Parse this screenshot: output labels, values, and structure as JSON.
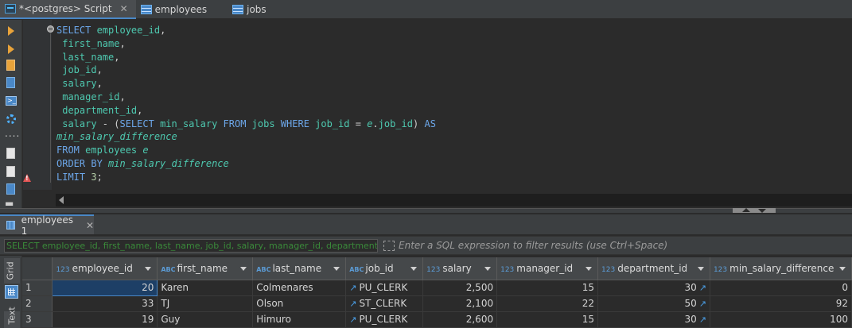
{
  "tabs": [
    {
      "label": "*<postgres> Script",
      "icon": "sql-script-icon",
      "active": true
    },
    {
      "label": "employees",
      "icon": "table-icon"
    },
    {
      "label": "jobs",
      "icon": "table-icon"
    }
  ],
  "editor": {
    "lines": [
      [
        {
          "t": "SELECT ",
          "c": "kw"
        },
        {
          "t": "employee_id",
          "c": "id"
        },
        {
          "t": ",",
          "c": "pl"
        }
      ],
      [
        {
          "t": " first_name",
          "c": "id"
        },
        {
          "t": ",",
          "c": "pl"
        }
      ],
      [
        {
          "t": " last_name",
          "c": "id"
        },
        {
          "t": ",",
          "c": "pl"
        }
      ],
      [
        {
          "t": " job_id",
          "c": "id"
        },
        {
          "t": ",",
          "c": "pl"
        }
      ],
      [
        {
          "t": " salary",
          "c": "id"
        },
        {
          "t": ",",
          "c": "pl"
        }
      ],
      [
        {
          "t": " manager_id",
          "c": "id"
        },
        {
          "t": ",",
          "c": "pl"
        }
      ],
      [
        {
          "t": " department_id",
          "c": "id"
        },
        {
          "t": ",",
          "c": "pl"
        }
      ],
      [
        {
          "t": " salary",
          "c": "id"
        },
        {
          "t": " - (",
          "c": "pl"
        },
        {
          "t": "SELECT ",
          "c": "kw"
        },
        {
          "t": "min_salary ",
          "c": "id"
        },
        {
          "t": "FROM ",
          "c": "kw"
        },
        {
          "t": "jobs ",
          "c": "id"
        },
        {
          "t": "WHERE ",
          "c": "kw"
        },
        {
          "t": "job_id ",
          "c": "id"
        },
        {
          "t": "= ",
          "c": "pl"
        },
        {
          "t": "e",
          "c": "it"
        },
        {
          "t": ".",
          "c": "pl"
        },
        {
          "t": "job_id",
          "c": "id"
        },
        {
          "t": ") ",
          "c": "pl"
        },
        {
          "t": "AS",
          "c": "kw"
        }
      ],
      [
        {
          "t": "min_salary_difference",
          "c": "it"
        }
      ],
      [
        {
          "t": "FROM ",
          "c": "kw"
        },
        {
          "t": "employees ",
          "c": "id"
        },
        {
          "t": "e",
          "c": "it"
        }
      ],
      [
        {
          "t": "ORDER BY ",
          "c": "kw"
        },
        {
          "t": "min_salary_difference",
          "c": "it"
        }
      ],
      [
        {
          "t": "LIMIT ",
          "c": "kw"
        },
        {
          "t": "3",
          "c": "nm"
        },
        {
          "t": ";",
          "c": "pl"
        }
      ]
    ]
  },
  "results": {
    "tab_label": "employees 1",
    "filter_query": "SELECT employee_id, first_name, last_name, job_id, salary, manager_id, department_i",
    "filter_placeholder": "Enter a SQL expression to filter results (use Ctrl+Space)",
    "side_tabs": {
      "grid": "Grid",
      "text": "Text"
    },
    "columns": [
      {
        "name": "employee_id",
        "type": "123"
      },
      {
        "name": "first_name",
        "type": "ABC"
      },
      {
        "name": "last_name",
        "type": "ABC"
      },
      {
        "name": "job_id",
        "type": "ABC"
      },
      {
        "name": "salary",
        "type": "123"
      },
      {
        "name": "manager_id",
        "type": "123"
      },
      {
        "name": "department_id",
        "type": "123"
      },
      {
        "name": "min_salary_difference",
        "type": "123"
      }
    ],
    "rows": [
      {
        "n": "1",
        "employee_id": "20",
        "first_name": "Karen",
        "last_name": "Colmenares",
        "job_id": "PU_CLERK",
        "salary": "2,500",
        "manager_id": "15",
        "department_id": "30",
        "min_salary_difference": "0"
      },
      {
        "n": "2",
        "employee_id": "33",
        "first_name": "TJ",
        "last_name": "Olson",
        "job_id": "ST_CLERK",
        "salary": "2,100",
        "manager_id": "22",
        "department_id": "50",
        "min_salary_difference": "92"
      },
      {
        "n": "3",
        "employee_id": "19",
        "first_name": "Guy",
        "last_name": "Himuro",
        "job_id": "PU_CLERK",
        "salary": "2,600",
        "manager_id": "15",
        "department_id": "30",
        "min_salary_difference": "100"
      }
    ]
  }
}
